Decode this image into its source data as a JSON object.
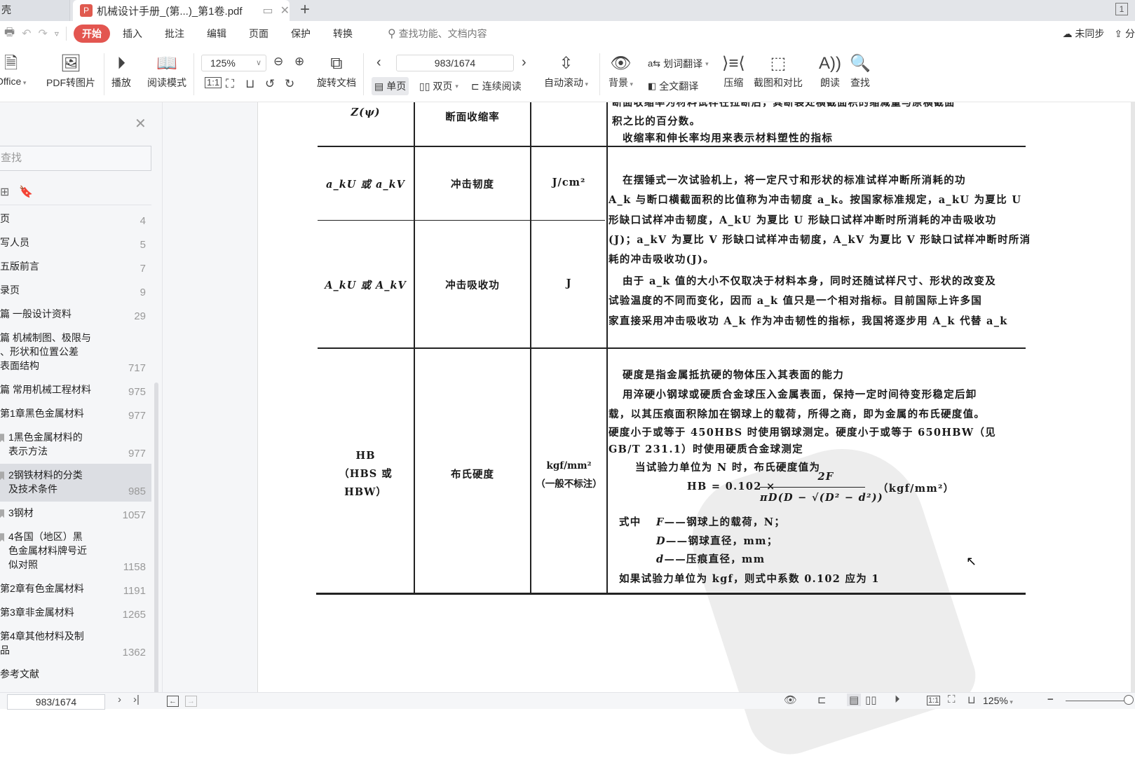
{
  "tabs": {
    "prev_tab_label": "壳",
    "active_tab_title": "机械设计手册_(第...)_第1卷.pdf",
    "add_tab": "+",
    "window_count": "1"
  },
  "menu": {
    "items": [
      "开始",
      "插入",
      "批注",
      "编辑",
      "页面",
      "保护",
      "转换"
    ],
    "search_placeholder": "查找功能、文档内容",
    "sync_label": "未同步",
    "share_label": "分"
  },
  "ribbon": {
    "to_office": "Office",
    "pdf_to_image": "PDF转图片",
    "play": "播放",
    "read_mode": "阅读模式",
    "zoom_value": "125%",
    "rotate_doc": "旋转文档",
    "page_value": "983/1674",
    "single_page": "单页",
    "double_page": "双页",
    "continuous": "连续阅读",
    "auto_scroll": "自动滚动",
    "background": "背景",
    "word_translate": "划词翻译",
    "full_translate": "全文翻译",
    "compress": "压缩",
    "screenshot_compare": "截图和对比",
    "read_aloud": "朗读",
    "find": "查找"
  },
  "sidebar": {
    "search_placeholder": "查找",
    "toc": [
      {
        "label": "页",
        "page": "4",
        "level": 0
      },
      {
        "label": "写人员",
        "page": "5",
        "level": 0
      },
      {
        "label": "五版前言",
        "page": "7",
        "level": 0
      },
      {
        "label": "录页",
        "page": "9",
        "level": 0
      },
      {
        "label": "篇 一般设计资料",
        "page": "29",
        "level": 0
      },
      {
        "label": "篇 机械制图、极限与\n、形状和位置公差\n表面结构",
        "page": "717",
        "level": 0
      },
      {
        "label": "篇 常用机械工程材料",
        "page": "975",
        "level": 0
      },
      {
        "label": "第1章黑色金属材料",
        "page": "977",
        "level": 0
      },
      {
        "label": "1黑色金属材料的\n表示方法",
        "page": "977",
        "level": 1
      },
      {
        "label": "2钢铁材料的分类\n及技术条件",
        "page": "985",
        "level": 1,
        "selected": true
      },
      {
        "label": "3钢材",
        "page": "1057",
        "level": 1
      },
      {
        "label": "4各国（地区）黑\n色金属材料牌号近\n似对照",
        "page": "1158",
        "level": 1
      },
      {
        "label": "第2章有色金属材料",
        "page": "1191",
        "level": 0
      },
      {
        "label": "第3章非金属材料",
        "page": "1265",
        "level": 0
      },
      {
        "label": "第4章其他材料及制\n品",
        "page": "1362",
        "level": 0
      },
      {
        "label": "参考文献",
        "page": "",
        "level": 0
      }
    ]
  },
  "document": {
    "row1": {
      "symbol": "Z(ψ)",
      "name": "断面收缩率",
      "unit": "",
      "desc": [
        "断面收缩率为材料试样在拉断后，其断裂处横截面积的缩减量与原横截面",
        "积之比的百分数。",
        "收缩率和伸长率均用来表示材料塑性的指标"
      ]
    },
    "row2": {
      "symbol": "a_kU 或 a_kV",
      "name": "冲击韧度",
      "unit": "J/cm²"
    },
    "row3": {
      "symbol": "A_kU 或 A_kV",
      "name": "冲击吸收功",
      "unit": "J"
    },
    "impact_desc": [
      "在摆锤式一次试验机上，将一定尺寸和形状的标准试样冲断所消耗的功",
      "A_k 与断口横截面积的比值称为冲击韧度 a_k。按国家标准规定，a_kU 为夏比 U",
      "形缺口试样冲击韧度，A_kU 为夏比 U 形缺口试样冲断时所消耗的冲击吸收功",
      "(J)；a_kV 为夏比 V 形缺口试样冲击韧度，A_kV 为夏比 V 形缺口试样冲断时所消",
      "耗的冲击吸收功(J)。",
      "由于 a_k 值的大小不仅取决于材料本身，同时还随试样尺寸、形状的改变及",
      "试验温度的不同而变化，因而 a_k 值只是一个相对指标。目前国际上许多国",
      "家直接采用冲击吸收功 A_k 作为冲击韧性的指标，我国将逐步用 A_k 代替 a_k"
    ],
    "row4": {
      "symbol_lines": [
        "HB",
        "（HBS 或",
        "HBW）"
      ],
      "name": "布氏硬度",
      "unit_lines": [
        "kgf/mm²",
        "（一般不标注）"
      ],
      "desc": [
        "硬度是指金属抵抗硬的物体压入其表面的能力",
        "用淬硬小钢球或硬质合金球压入金属表面，保持一定时间待变形稳定后卸",
        "载，以其压痕面积除加在钢球上的载荷，所得之商，即为金属的布氏硬度值。",
        "硬度小于或等于 450HBS 时使用钢球测定。硬度小于或等于 650HBW（见",
        "GB/T 231.1）时使用硬质合金球测定",
        "当试验力单位为 N 时，布氏硬度值为"
      ],
      "formula_lhs": "HB = 0.102 ×",
      "formula_num": "2F",
      "formula_den": "πD(D − √(D² − d²))",
      "formula_unit": "（kgf/mm²）",
      "where_label": "式中",
      "vars": [
        {
          "sym": "F",
          "desc": "——钢球上的载荷，N；"
        },
        {
          "sym": "D",
          "desc": "——钢球直径，mm；"
        },
        {
          "sym": "d",
          "desc": "——压痕直径，mm"
        }
      ],
      "note": "如果试验力单位为 kgf，则式中系数 0.102 应为 1"
    }
  },
  "statusbar": {
    "page_value": "983/1674",
    "zoom_value": "125%"
  }
}
